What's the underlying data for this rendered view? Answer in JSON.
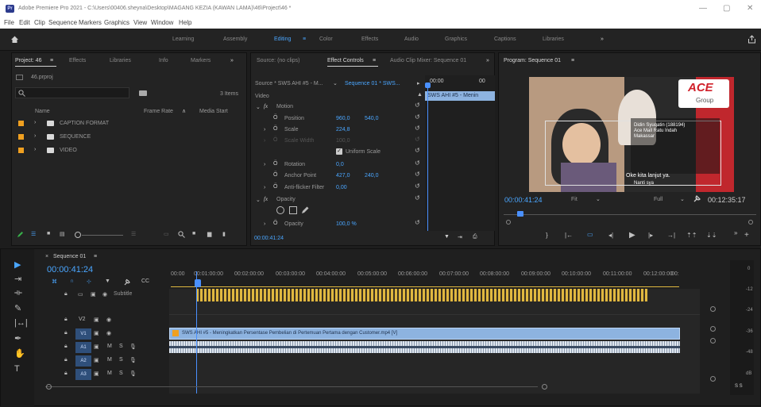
{
  "window": {
    "title": "Adobe Premiere Pro 2021 - C:\\Users\\00406.sheyna\\Desktop\\MAGANG KEZIA (KAWAN LAMA)\\46\\Project\\46 *",
    "minimize": "—",
    "maximize": "▢",
    "close": "✕"
  },
  "menu": [
    "File",
    "Edit",
    "Clip",
    "Sequence",
    "Markers",
    "Graphics",
    "View",
    "Window",
    "Help"
  ],
  "workspaces": [
    "Learning",
    "Assembly",
    "Editing",
    "Color",
    "Effects",
    "Audio",
    "Graphics",
    "Captions",
    "Libraries",
    "»"
  ],
  "workspace_active": "Editing",
  "project_panel": {
    "tabs": [
      "Project: 46",
      "Effects",
      "Libraries",
      "Info",
      "Markers",
      "»"
    ],
    "file": "46.prproj",
    "item_count": "3 Items",
    "col_name": "Name",
    "col_framerate": "Frame Rate",
    "col_mediastart": "Media Start",
    "items": [
      "CAPTION FORMAT",
      "SEQUENCE",
      "VIDEO"
    ]
  },
  "effect_controls": {
    "tabs": [
      "Source: (no clips)",
      "Effect Controls",
      "Audio Clip Mixer: Sequence 01",
      "»"
    ],
    "source": "Source * SWS AHI #5 - M...",
    "sequence": "Sequence 01 * SWS...",
    "clip_label": "SWS AHI #5 - Menin",
    "mini_time": "00:00",
    "section_video": "Video",
    "motion": "Motion",
    "position": "Position",
    "position_x": "960,0",
    "position_y": "540,0",
    "scale": "Scale",
    "scale_val": "224,8",
    "scale_width": "Scale Width",
    "scale_width_val": "100,0",
    "uniform_scale": "Uniform Scale",
    "rotation": "Rotation",
    "rotation_val": "0,0",
    "anchor_point": "Anchor Point",
    "anchor_x": "427,0",
    "anchor_y": "240,0",
    "anti_flicker": "Anti-flicker Filter",
    "anti_flicker_val": "0,00",
    "opacity_section": "Opacity",
    "opacity": "Opacity",
    "opacity_val": "100,0 %",
    "timecode": "00:00:41:24"
  },
  "program_monitor": {
    "tab": "Program: Sequence 01",
    "timecode": "00:00:41:24",
    "fit": "Fit",
    "quality": "Full",
    "duration": "00:12:35:17",
    "logo": "ACE",
    "logo_sub": "Group",
    "caption": "Oke kita lanjut ya.",
    "caption_sub": "Nanti sya",
    "info_name": "Didin Syuqatin (188194)",
    "info_role": "Ace Mall Ratu Indah",
    "info_city": "Makassar"
  },
  "timeline": {
    "tab": "Sequence 01",
    "timecode": "00:00:41:24",
    "ruler": [
      "00:00",
      "00:01:00:00",
      "00:02:00:00",
      "00:03:00:00",
      "00:04:00:00",
      "00:05:00:00",
      "00:06:00:00",
      "00:07:00:00",
      "00:08:00:00",
      "00:09:00:00",
      "00:10:00:00",
      "00:11:00:00",
      "00:12:00:00",
      "00:13:00:0"
    ],
    "tracks": [
      "Subtitle",
      "V2",
      "V1",
      "A1",
      "A2",
      "A3"
    ],
    "video_clip": "SWS AHI #5 - Meningkatkan Persentase Pembelian di Pertemuan Pertama dengan Customer.mp4 [V]",
    "meter_labels": [
      "0",
      "-12",
      "-24",
      "-36",
      "-48",
      "dB"
    ],
    "meter_footer": "S S"
  },
  "colors": {
    "accent": "#4aa6ff",
    "label_orange": "#f0a020",
    "clip_blue": "#8db3e0",
    "caption_bar": "#e0b840",
    "playhead": "#4a90ff"
  }
}
